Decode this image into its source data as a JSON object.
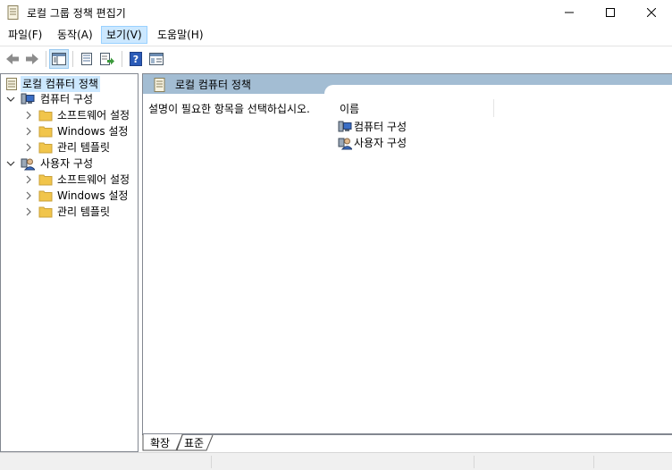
{
  "window": {
    "title": "로컬 그룹 정책 편집기",
    "icons": {
      "app": "document-policy-icon",
      "minimize": "minimize-icon",
      "maximize": "maximize-icon",
      "close": "close-icon"
    }
  },
  "menu": {
    "file": "파일(F)",
    "action": "동작(A)",
    "view": "보기(V)",
    "help": "도움말(H)"
  },
  "toolbar": {
    "buttons": [
      "back-arrow-icon",
      "forward-arrow-icon",
      "show-hide-tree-icon",
      "properties-icon",
      "export-list-icon",
      "help-icon",
      "extended-view-icon"
    ]
  },
  "tree": {
    "root": "로컬 컴퓨터 정책",
    "computer": {
      "label": "컴퓨터 구성",
      "children": [
        "소프트웨어 설정",
        "Windows 설정",
        "관리 템플릿"
      ]
    },
    "user": {
      "label": "사용자 구성",
      "children": [
        "소프트웨어 설정",
        "Windows 설정",
        "관리 템플릿"
      ]
    }
  },
  "content": {
    "header": "로컬 컴퓨터 정책",
    "description": "설명이 필요한 항목을 선택하십시오.",
    "column_name": "이름",
    "items": [
      "컴퓨터 구성",
      "사용자 구성"
    ]
  },
  "tabs": {
    "extended": "확장",
    "standard": "표준"
  },
  "colors": {
    "header_bg": "#a3bdd3",
    "selection_bg": "#cce8ff",
    "folder": "#f1c54b",
    "help_blue": "#2b5bb8"
  }
}
